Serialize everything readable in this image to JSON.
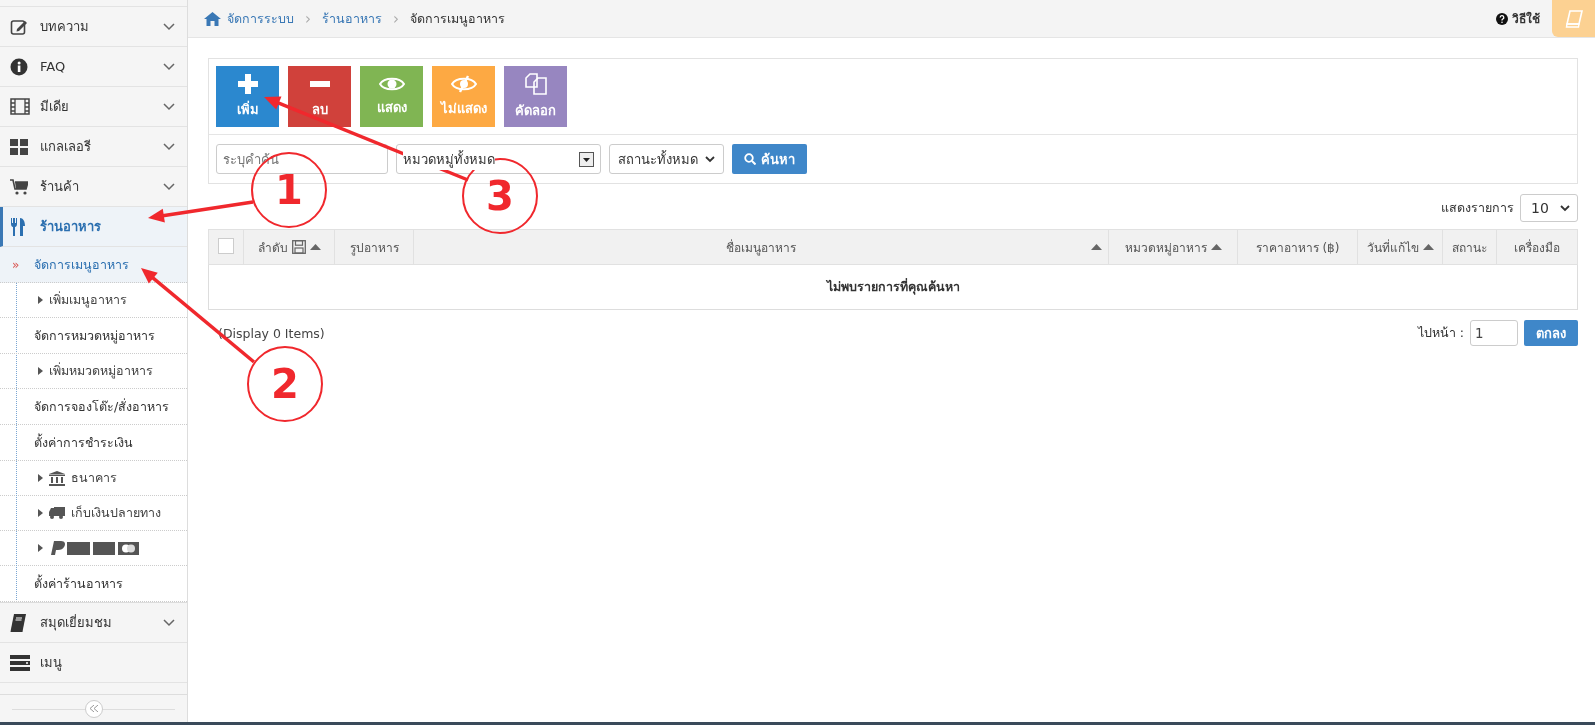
{
  "sidebar": {
    "items": [
      {
        "label": "บทความ",
        "kind": "edit",
        "selected": false,
        "expanded": false
      },
      {
        "label": "FAQ",
        "kind": "info",
        "selected": false,
        "expanded": false
      },
      {
        "label": "มีเดีย",
        "kind": "film",
        "selected": false,
        "expanded": false
      },
      {
        "label": "แกลเลอรี",
        "kind": "grid",
        "selected": false,
        "expanded": false
      },
      {
        "label": "ร้านค้า",
        "kind": "cart",
        "selected": false,
        "expanded": false
      },
      {
        "label": "ร้านอาหาร",
        "kind": "food",
        "selected": true,
        "expanded": true,
        "children": [
          {
            "label": "จัดการเมนูอาหาร",
            "selected": true,
            "marker": "»",
            "children": [
              {
                "label": "เพิ่มเมนูอาหาร",
                "kind": "plain"
              }
            ]
          },
          {
            "label": "จัดการหมวดหมู่อาหาร",
            "selected": false,
            "children": [
              {
                "label": "เพิ่มหมวดหมู่อาหาร",
                "kind": "plain"
              }
            ]
          },
          {
            "label": "จัดการจองโต๊ะ/สั่งอาหาร",
            "selected": false
          },
          {
            "label": "ตั้งค่าการชำระเงิน",
            "selected": false,
            "children": [
              {
                "label": "ธนาคาร",
                "kind": "bank"
              },
              {
                "label": "เก็บเงินปลายทาง",
                "kind": "truck"
              },
              {
                "kind": "cards"
              }
            ]
          },
          {
            "label": "ตั้งค่าร้านอาหาร",
            "selected": false
          }
        ]
      },
      {
        "label": "สมุดเยี่ยมชม",
        "kind": "book",
        "selected": false,
        "expanded": false
      },
      {
        "label": "เมนู",
        "kind": "menu",
        "selected": false,
        "expanded": false,
        "chevron": false
      }
    ]
  },
  "breadcrumb": [
    {
      "label": "จัดการระบบ",
      "kind": "link"
    },
    {
      "label": "ร้านอาหาร",
      "kind": "link",
      "separator": "›"
    },
    {
      "label": "จัดการเมนูอาหาร",
      "kind": "current",
      "separator": "›"
    }
  ],
  "help": {
    "label": "วิธีใช้"
  },
  "toolbar": [
    {
      "label": "เพิ่ม",
      "kind": "add",
      "color": "#2b88cf"
    },
    {
      "label": "ลบ",
      "kind": "delete",
      "color": "#d0413b"
    },
    {
      "label": "แสดง",
      "kind": "show",
      "color": "#80b553"
    },
    {
      "label": "ไม่แสดง",
      "kind": "hide",
      "color": "#fda943"
    },
    {
      "label": "คัดลอก",
      "kind": "copy",
      "color": "#9786c0"
    }
  ],
  "filters": {
    "search": {
      "placeholder": "ระบุคำค้น"
    },
    "category": {
      "value": "หมวดหมู่ทั้งหมด"
    },
    "status": {
      "value": "สถานะทั้งหมด"
    },
    "button": "ค้นหา"
  },
  "page_size": {
    "label": "แสดงรายการ",
    "value": "10"
  },
  "table": {
    "columns": [
      {
        "kind": "checkbox",
        "checked": false
      },
      {
        "kind": "text",
        "label": "ลำดับ",
        "save": true,
        "sortable": true
      },
      {
        "kind": "text",
        "label": "รูปอาหาร",
        "sortable": false
      },
      {
        "kind": "text",
        "label": "ชื่อเมนูอาหาร",
        "sortable": true
      },
      {
        "kind": "text",
        "label": "หมวดหมู่อาหาร",
        "sortable": true
      },
      {
        "kind": "text",
        "label": "ราคาอาหาร (฿)",
        "sortable": false
      },
      {
        "kind": "text",
        "label": "วันที่แก้ไข",
        "sortable": true
      },
      {
        "kind": "text",
        "label": "สถานะ",
        "sortable": false
      },
      {
        "kind": "text",
        "label": "เครื่องมือ",
        "sortable": false
      }
    ],
    "empty_message": "ไม่พบรายการที่คุณค้นหา"
  },
  "display_count": "(Display 0 Items)",
  "pagination": {
    "label": "ไปหน้า :",
    "value": "1",
    "button": "ตกลง"
  },
  "annotations": [
    {
      "label": "1"
    },
    {
      "label": "2"
    },
    {
      "label": "3"
    }
  ]
}
